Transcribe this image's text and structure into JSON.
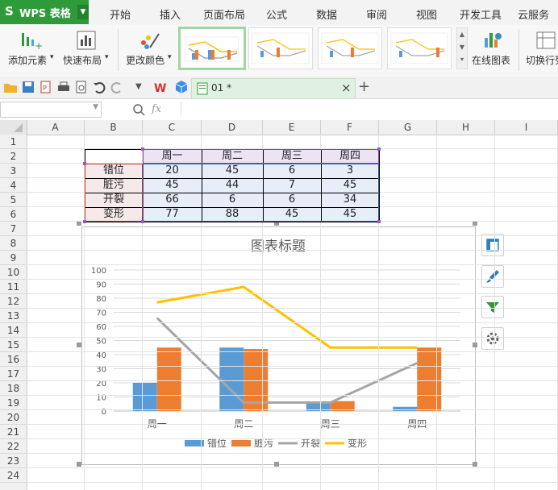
{
  "app": {
    "logo_letter": "S",
    "name": "WPS 表格",
    "menu": [
      "开始",
      "插入",
      "页面布局",
      "公式",
      "数据",
      "审阅",
      "视图",
      "开发工具",
      "云服务"
    ]
  },
  "ribbon": {
    "add_element": "添加元素",
    "quick_layout": "快速布局",
    "change_color": "更改颜色",
    "online_chart": "在线图表",
    "switch_rowcol": "切换行列",
    "dropdown_mark": "▾"
  },
  "toolbar": {
    "doc_tab": "01 *",
    "close": "×",
    "add": "+"
  },
  "formula_bar": {
    "name_box": "",
    "fx": "fx"
  },
  "grid": {
    "columns": [
      "A",
      "B",
      "C",
      "D",
      "E",
      "F",
      "G",
      "H",
      "I"
    ],
    "rows": [
      "1",
      "2",
      "3",
      "4",
      "5",
      "6",
      "7",
      "8",
      "9",
      "10",
      "11",
      "12",
      "13",
      "14",
      "15",
      "16",
      "17",
      "18",
      "19",
      "20",
      "21",
      "22",
      "23",
      "24"
    ]
  },
  "table": {
    "headers": [
      "周一",
      "周二",
      "周三",
      "周四"
    ],
    "rows": [
      {
        "label": "错位",
        "values": [
          "20",
          "45",
          "6",
          "3"
        ]
      },
      {
        "label": "脏污",
        "values": [
          "45",
          "44",
          "7",
          "45"
        ]
      },
      {
        "label": "开裂",
        "values": [
          "66",
          "6",
          "6",
          "34"
        ]
      },
      {
        "label": "变形",
        "values": [
          "77",
          "88",
          "45",
          "45"
        ]
      }
    ]
  },
  "colors": {
    "wps_green": "#2f9a3a",
    "series_blue": "#5b9bd5",
    "series_orange": "#ed7d31",
    "series_gray": "#a5a5a5",
    "series_yellow": "#ffc000"
  },
  "chart_data": {
    "type": "bar",
    "title": "图表标题",
    "categories": [
      "周一",
      "周二",
      "周三",
      "周四"
    ],
    "ylim": [
      0,
      100
    ],
    "yticks": [
      0,
      10,
      20,
      30,
      40,
      50,
      60,
      70,
      80,
      90,
      100
    ],
    "grid": true,
    "legend": "bottom",
    "series": [
      {
        "name": "错位",
        "kind": "bar",
        "color": "#5b9bd5",
        "values": [
          20,
          45,
          6,
          3
        ]
      },
      {
        "name": "脏污",
        "kind": "bar",
        "color": "#ed7d31",
        "values": [
          45,
          44,
          7,
          45
        ]
      },
      {
        "name": "开裂",
        "kind": "line",
        "color": "#a5a5a5",
        "values": [
          66,
          6,
          6,
          34
        ]
      },
      {
        "name": "变形",
        "kind": "line",
        "color": "#ffc000",
        "values": [
          77,
          88,
          45,
          45
        ]
      }
    ]
  },
  "side_tools": [
    "chart-elements-icon",
    "chart-style-icon",
    "chart-filter-icon",
    "chart-settings-icon"
  ]
}
